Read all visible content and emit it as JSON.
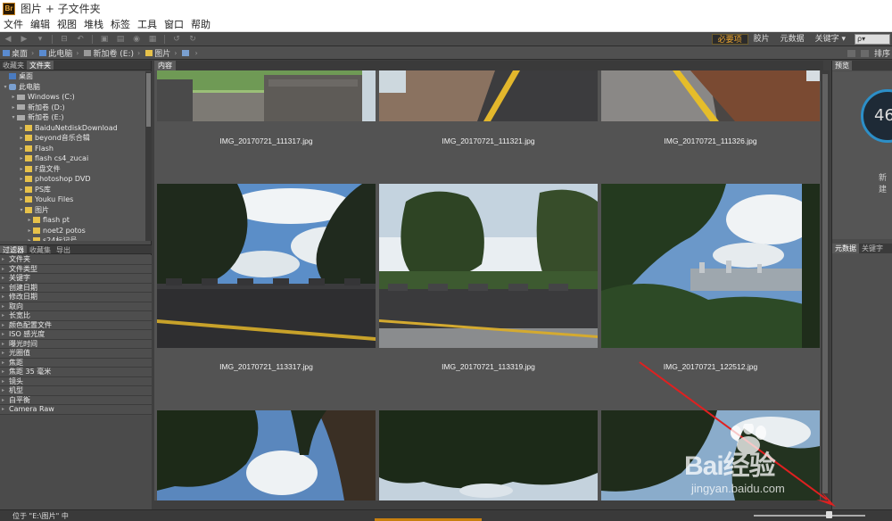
{
  "window": {
    "title": "图片 + 子文件夹",
    "logo": "Br"
  },
  "menu": [
    "文件",
    "编辑",
    "视图",
    "堆栈",
    "标签",
    "工具",
    "窗口",
    "帮助"
  ],
  "toolbar": {
    "workspaces": [
      "必要项",
      "胶片",
      "元数据",
      "关键字 ▾"
    ],
    "active_workspace": "必要项",
    "search_placeholder": "ρ▾"
  },
  "pathbar": {
    "segments": [
      "桌面",
      "此电脑",
      "新加卷 (E:)",
      "图片",
      ""
    ],
    "sort_label": "排序"
  },
  "left_panel": {
    "tabs": [
      "收藏夹",
      "文件夹"
    ],
    "tree": [
      {
        "label": "桌面",
        "type": "desk",
        "indent": 0,
        "arrow": ""
      },
      {
        "label": "此电脑",
        "type": "pc",
        "indent": 0,
        "arrow": "▾"
      },
      {
        "label": "Windows (C:)",
        "type": "drive",
        "indent": 1,
        "arrow": "▸"
      },
      {
        "label": "新加卷 (D:)",
        "type": "drive",
        "indent": 1,
        "arrow": "▸"
      },
      {
        "label": "新加卷 (E:)",
        "type": "drive",
        "indent": 1,
        "arrow": "▾"
      },
      {
        "label": "BaiduNetdiskDownload",
        "type": "folder",
        "indent": 2,
        "arrow": "▸"
      },
      {
        "label": "beyond音乐合辑",
        "type": "folder",
        "indent": 2,
        "arrow": "▸"
      },
      {
        "label": "Flash",
        "type": "folder",
        "indent": 2,
        "arrow": "▸"
      },
      {
        "label": "flash cs4_zucai",
        "type": "folder",
        "indent": 2,
        "arrow": "▸"
      },
      {
        "label": "F盘文件",
        "type": "folder",
        "indent": 2,
        "arrow": "▸"
      },
      {
        "label": "photoshop DVD",
        "type": "folder",
        "indent": 2,
        "arrow": "▸"
      },
      {
        "label": "PS库",
        "type": "folder",
        "indent": 2,
        "arrow": "▸"
      },
      {
        "label": "Youku Files",
        "type": "folder",
        "indent": 2,
        "arrow": "▸"
      },
      {
        "label": "图片",
        "type": "folder",
        "indent": 2,
        "arrow": "▾"
      },
      {
        "label": "flash pt",
        "type": "folder",
        "indent": 3,
        "arrow": "▸"
      },
      {
        "label": "noet2 potos",
        "type": "folder",
        "indent": 3,
        "arrow": "▸"
      },
      {
        "label": "s24标记号",
        "type": "folder",
        "indent": 3,
        "arrow": "▸"
      }
    ],
    "filter_tabs": [
      "过滤器",
      "收藏集",
      "导出"
    ],
    "filters": [
      "文件夹",
      "文件类型",
      "关键字",
      "创建日期",
      "修改日期",
      "取向",
      "长宽比",
      "颜色配置文件",
      "ISO 感光度",
      "曝光时间",
      "光圈值",
      "焦距",
      "焦距 35 毫米",
      "镜头",
      "机型",
      "白平衡",
      "Camera Raw"
    ]
  },
  "content": {
    "tab": "内容",
    "thumbnails": [
      {
        "name": "IMG_20170721_111317.jpg",
        "scene": "wall-top"
      },
      {
        "name": "IMG_20170721_111321.jpg",
        "scene": "road-1"
      },
      {
        "name": "IMG_20170721_111326.jpg",
        "scene": "road-2"
      },
      {
        "name": "IMG_20170721_113317.jpg",
        "scene": "trees-wall"
      },
      {
        "name": "IMG_20170721_113319.jpg",
        "scene": "trees-wall-bright"
      },
      {
        "name": "IMG_20170721_122512.jpg",
        "scene": "city-view"
      },
      {
        "name": "",
        "scene": "canopy-1"
      },
      {
        "name": "",
        "scene": "canopy-2"
      },
      {
        "name": "",
        "scene": "canopy-3"
      }
    ]
  },
  "right_panel": {
    "tabs": [
      "预览"
    ],
    "preview_number": "46",
    "preview_caption": "新建",
    "tabs2": [
      "元数据",
      "关键字"
    ]
  },
  "statusbar": {
    "text": "位于 \"E:\\图片\" 中"
  },
  "watermark": {
    "brand": "Bai经验",
    "url": "jingyan.baidu.com"
  }
}
